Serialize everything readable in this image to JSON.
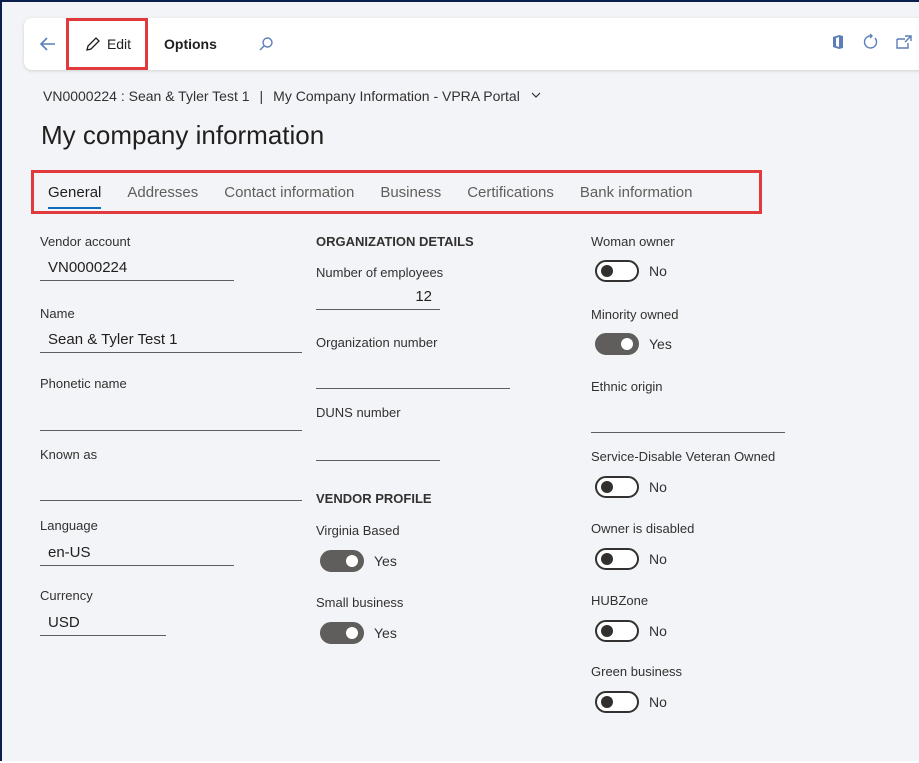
{
  "toolbar": {
    "edit_label": "Edit",
    "options_label": "Options"
  },
  "breadcrumb": {
    "record": "VN0000224 : Sean & Tyler Test 1",
    "separator": "|",
    "page": "My Company Information - VPRA Portal"
  },
  "title": "My company information",
  "tabs": [
    "General",
    "Addresses",
    "Contact information",
    "Business",
    "Certifications",
    "Bank information"
  ],
  "active_tab": "General",
  "col1": {
    "vendor_account_label": "Vendor account",
    "vendor_account_value": "VN0000224",
    "name_label": "Name",
    "name_value": "Sean & Tyler Test 1",
    "phonetic_label": "Phonetic name",
    "phonetic_value": "",
    "known_as_label": "Known as",
    "known_as_value": "",
    "language_label": "Language",
    "language_value": "en-US",
    "currency_label": "Currency",
    "currency_value": "USD"
  },
  "col2": {
    "org_section": "ORGANIZATION DETAILS",
    "employees_label": "Number of employees",
    "employees_value": "12",
    "org_number_label": "Organization number",
    "org_number_value": "",
    "duns_label": "DUNS number",
    "duns_value": "",
    "profile_section": "VENDOR PROFILE",
    "virginia_label": "Virginia Based",
    "virginia_value": "Yes",
    "small_label": "Small business",
    "small_value": "Yes"
  },
  "col3": {
    "woman_label": "Woman owner",
    "woman_value": "No",
    "minority_label": "Minority owned",
    "minority_value": "Yes",
    "ethnic_label": "Ethnic origin",
    "ethnic_value": "",
    "sdvo_label": "Service-Disable Veteran Owned",
    "sdvo_value": "No",
    "disabled_label": "Owner is disabled",
    "disabled_value": "No",
    "hub_label": "HUBZone",
    "hub_value": "No",
    "green_label": "Green business",
    "green_value": "No"
  },
  "colors": {
    "highlight": "#e0393e",
    "accent": "#0f6cbd",
    "frame": "#0b1f4d"
  }
}
